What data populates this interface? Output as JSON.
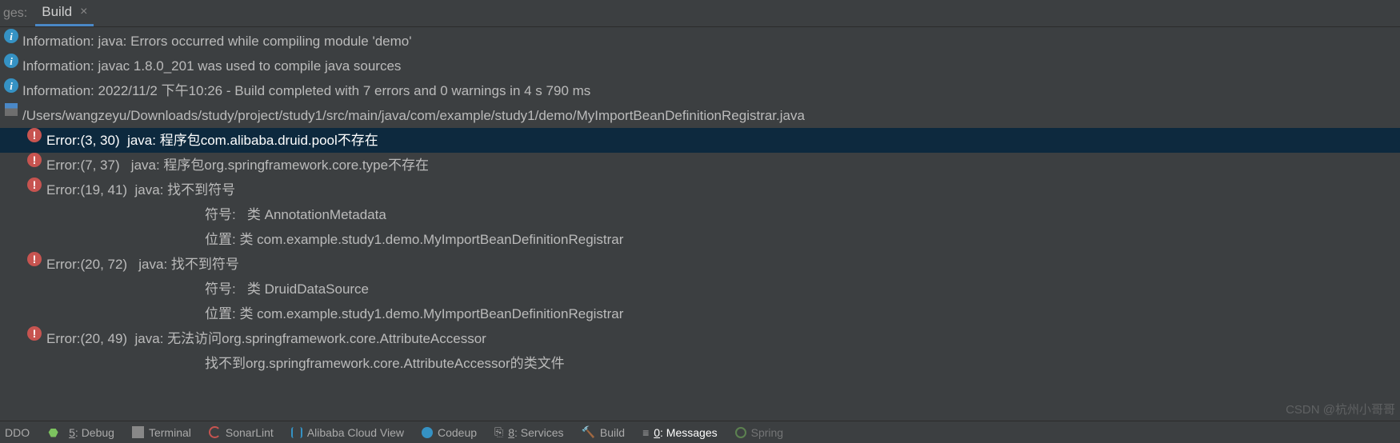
{
  "header": {
    "prefix": "ges:",
    "tab_label": "Build",
    "tab_close": "×"
  },
  "messages": [
    {
      "type": "info",
      "indent": 0,
      "text": "Information: java: Errors occurred while compiling module 'demo'"
    },
    {
      "type": "info",
      "indent": 0,
      "text": "Information: javac 1.8.0_201 was used to compile java sources"
    },
    {
      "type": "info",
      "indent": 0,
      "text": "Information: 2022/11/2 下午10:26 - Build completed with 7 errors and 0 warnings in 4 s 790 ms"
    },
    {
      "type": "file",
      "indent": 0,
      "text": "/Users/wangzeyu/Downloads/study/project/study1/src/main/java/com/example/study1/demo/MyImportBeanDefinitionRegistrar.java"
    },
    {
      "type": "error",
      "indent": 1,
      "selected": true,
      "text": "Error:(3, 30)  java: 程序包com.alibaba.druid.pool不存在"
    },
    {
      "type": "error",
      "indent": 1,
      "text": "Error:(7, 37)   java: 程序包org.springframework.core.type不存在"
    },
    {
      "type": "error",
      "indent": 1,
      "text": "Error:(19, 41)  java: 找不到符号"
    },
    {
      "type": "plain",
      "indent": 2,
      "text": "符号:   类 AnnotationMetadata"
    },
    {
      "type": "plain",
      "indent": 2,
      "text": "位置: 类 com.example.study1.demo.MyImportBeanDefinitionRegistrar"
    },
    {
      "type": "error",
      "indent": 1,
      "text": "Error:(20, 72)   java: 找不到符号"
    },
    {
      "type": "plain",
      "indent": 2,
      "text": "符号:   类 DruidDataSource"
    },
    {
      "type": "plain",
      "indent": 2,
      "text": "位置: 类 com.example.study1.demo.MyImportBeanDefinitionRegistrar"
    },
    {
      "type": "error",
      "indent": 1,
      "text": "Error:(20, 49)  java: 无法访问org.springframework.core.AttributeAccessor"
    },
    {
      "type": "plain",
      "indent": 2,
      "text": "找不到org.springframework.core.AttributeAccessor的类文件"
    }
  ],
  "bottombar": {
    "todo_trunc": "DDO",
    "debug": "5: Debug",
    "terminal": "Terminal",
    "sonarlint": "SonarLint",
    "alicloud": "Alibaba Cloud View",
    "codeup": "Codeup",
    "services": "8: Services",
    "build": "Build",
    "messages": "0: Messages",
    "spring_trunc": "Spring"
  },
  "watermark": "CSDN @杭州小哥哥"
}
